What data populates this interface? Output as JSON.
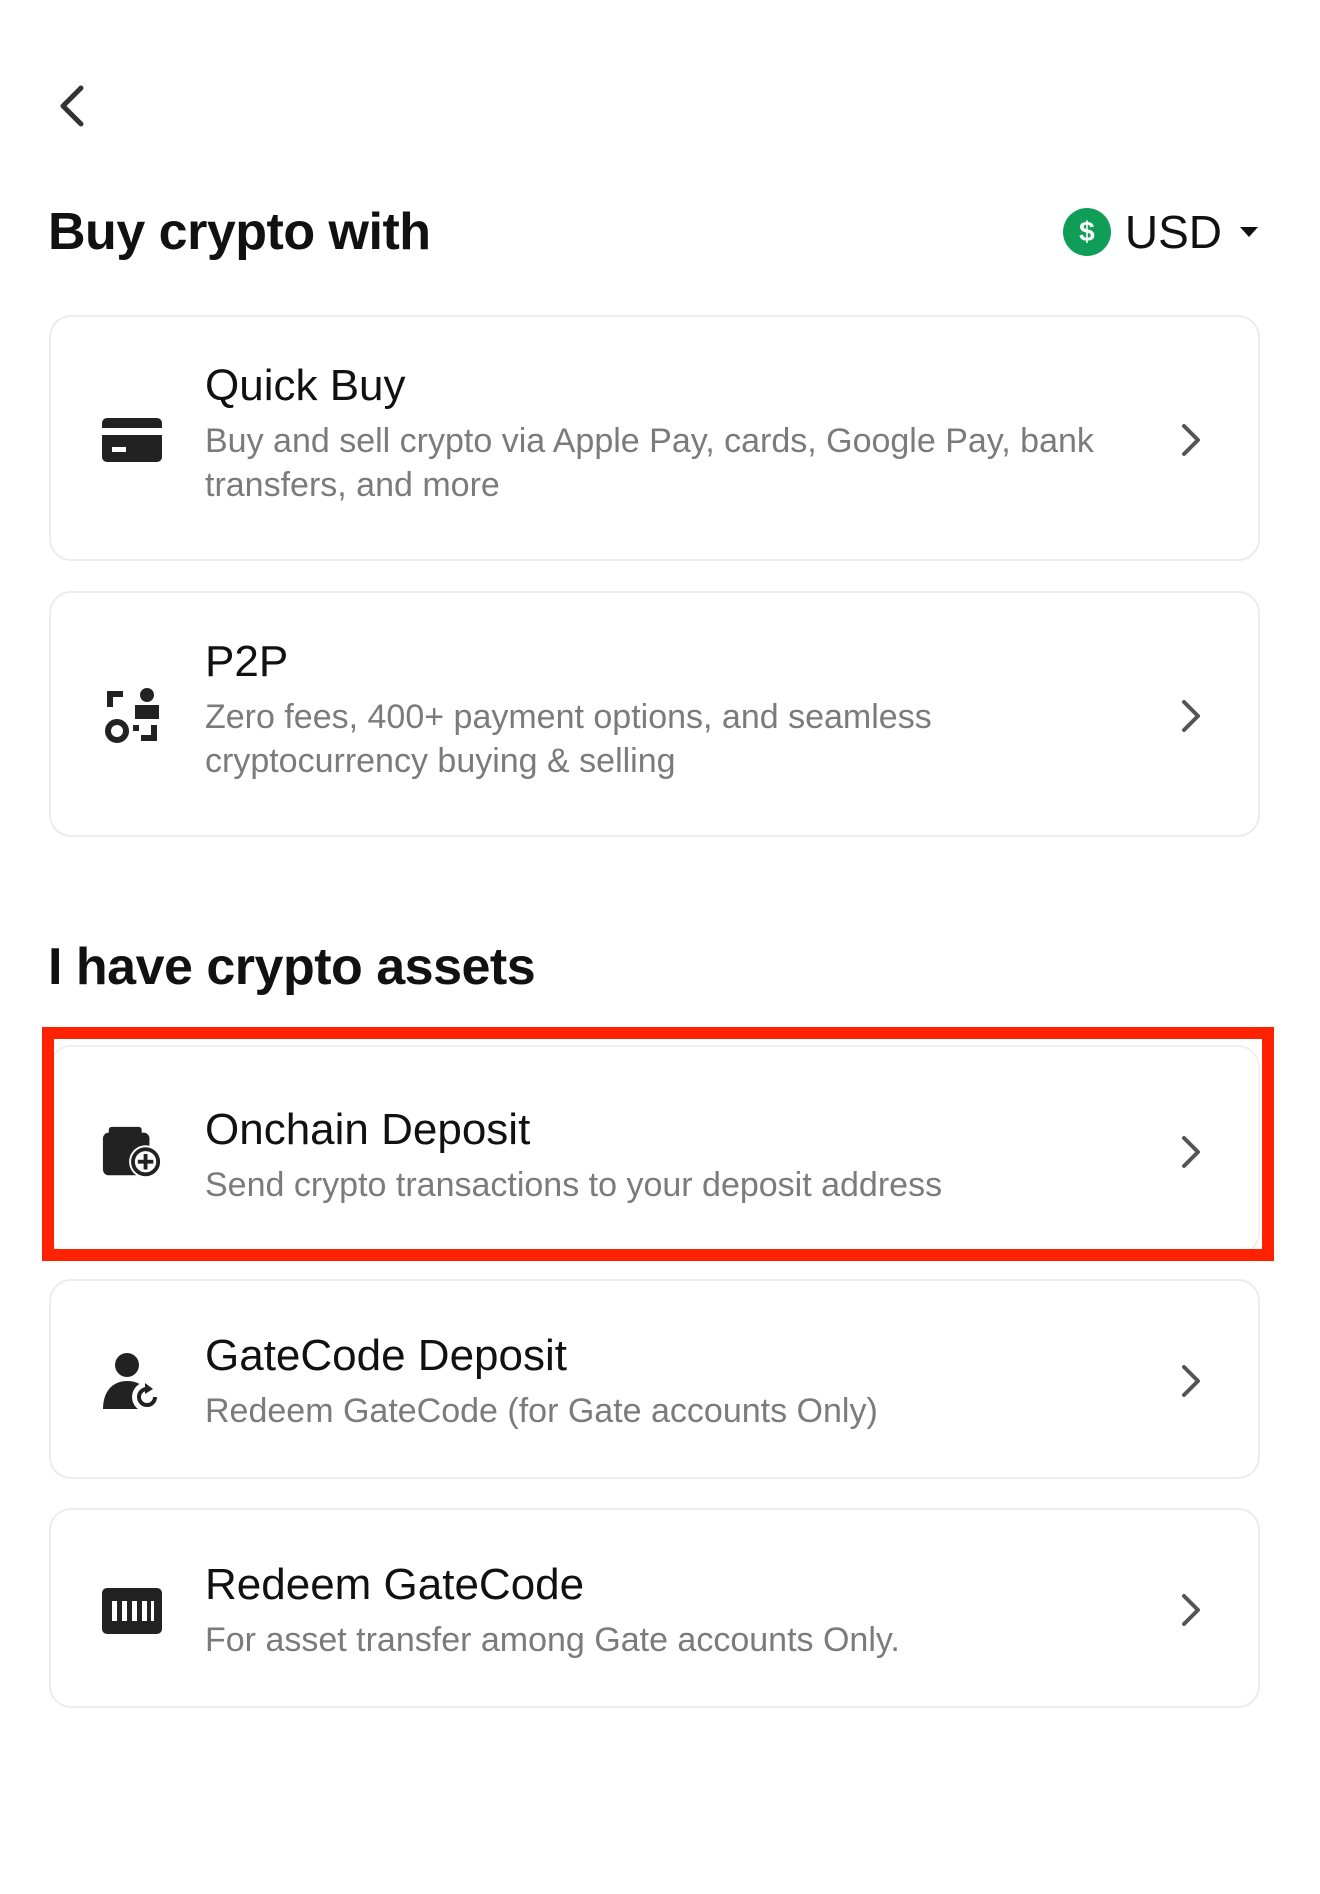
{
  "nav": {
    "back_icon": "chevron-left-icon"
  },
  "buy_section": {
    "title": "Buy crypto with",
    "currency": {
      "symbol": "$",
      "label": "USD",
      "icon_color": "#0f9d58"
    }
  },
  "buy_options": [
    {
      "name": "Quick Buy",
      "description": "Buy and sell crypto via Apple Pay, cards, Google Pay, bank transfers, and more",
      "icon": "credit-card-icon"
    },
    {
      "name": "P2P",
      "description": "Zero fees, 400+ payment options, and seamless cryptocurrency buying & selling",
      "icon": "p2p-exchange-icon"
    }
  ],
  "assets_section": {
    "title": "I have crypto assets"
  },
  "asset_options": [
    {
      "name": "Onchain Deposit",
      "description": "Send crypto transactions to your deposit address",
      "icon": "wallet-add-icon",
      "highlighted": true
    },
    {
      "name": "GateCode Deposit",
      "description": "Redeem GateCode (for Gate accounts Only)",
      "icon": "user-refresh-icon"
    },
    {
      "name": "Redeem GateCode",
      "description": "For asset transfer among Gate accounts Only.",
      "icon": "barcode-icon"
    }
  ],
  "colors": {
    "highlight": "#ff2200",
    "text_primary": "#111111",
    "text_secondary": "#7b7b7b"
  }
}
